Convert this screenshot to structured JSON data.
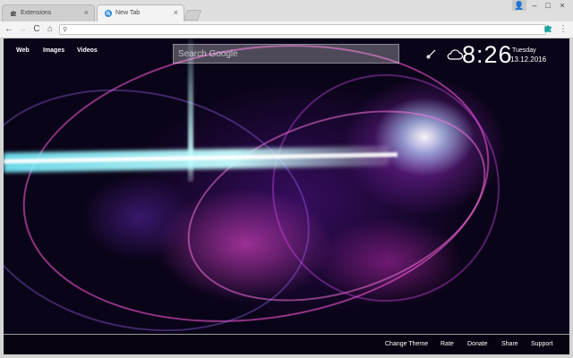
{
  "browser": {
    "tabs": [
      {
        "label": "Extensions",
        "active": false,
        "icon": "puzzle-icon"
      },
      {
        "label": "New Tab",
        "active": true,
        "icon": "newtab-search-icon"
      }
    ],
    "close_glyph": "×",
    "window_controls": {
      "user": "👤",
      "minimize": "–",
      "maximize": "□",
      "close": "×"
    },
    "address_value": "",
    "nav": {
      "back": "←",
      "forward": "→",
      "reload": "C",
      "home": "⌂"
    },
    "menu_glyph": "⋮",
    "extension_icon": "puzzle-icon-teal"
  },
  "page": {
    "nav_links": [
      "Web",
      "Images",
      "Videos"
    ],
    "search_placeholder": "Search Google",
    "time": "8:26",
    "day": "Tuesday",
    "date": "13.12.2016",
    "footer_links": [
      "Change Theme",
      "Rate",
      "Donate",
      "Share",
      "Support"
    ],
    "accent_color": "#1ea3a3"
  }
}
